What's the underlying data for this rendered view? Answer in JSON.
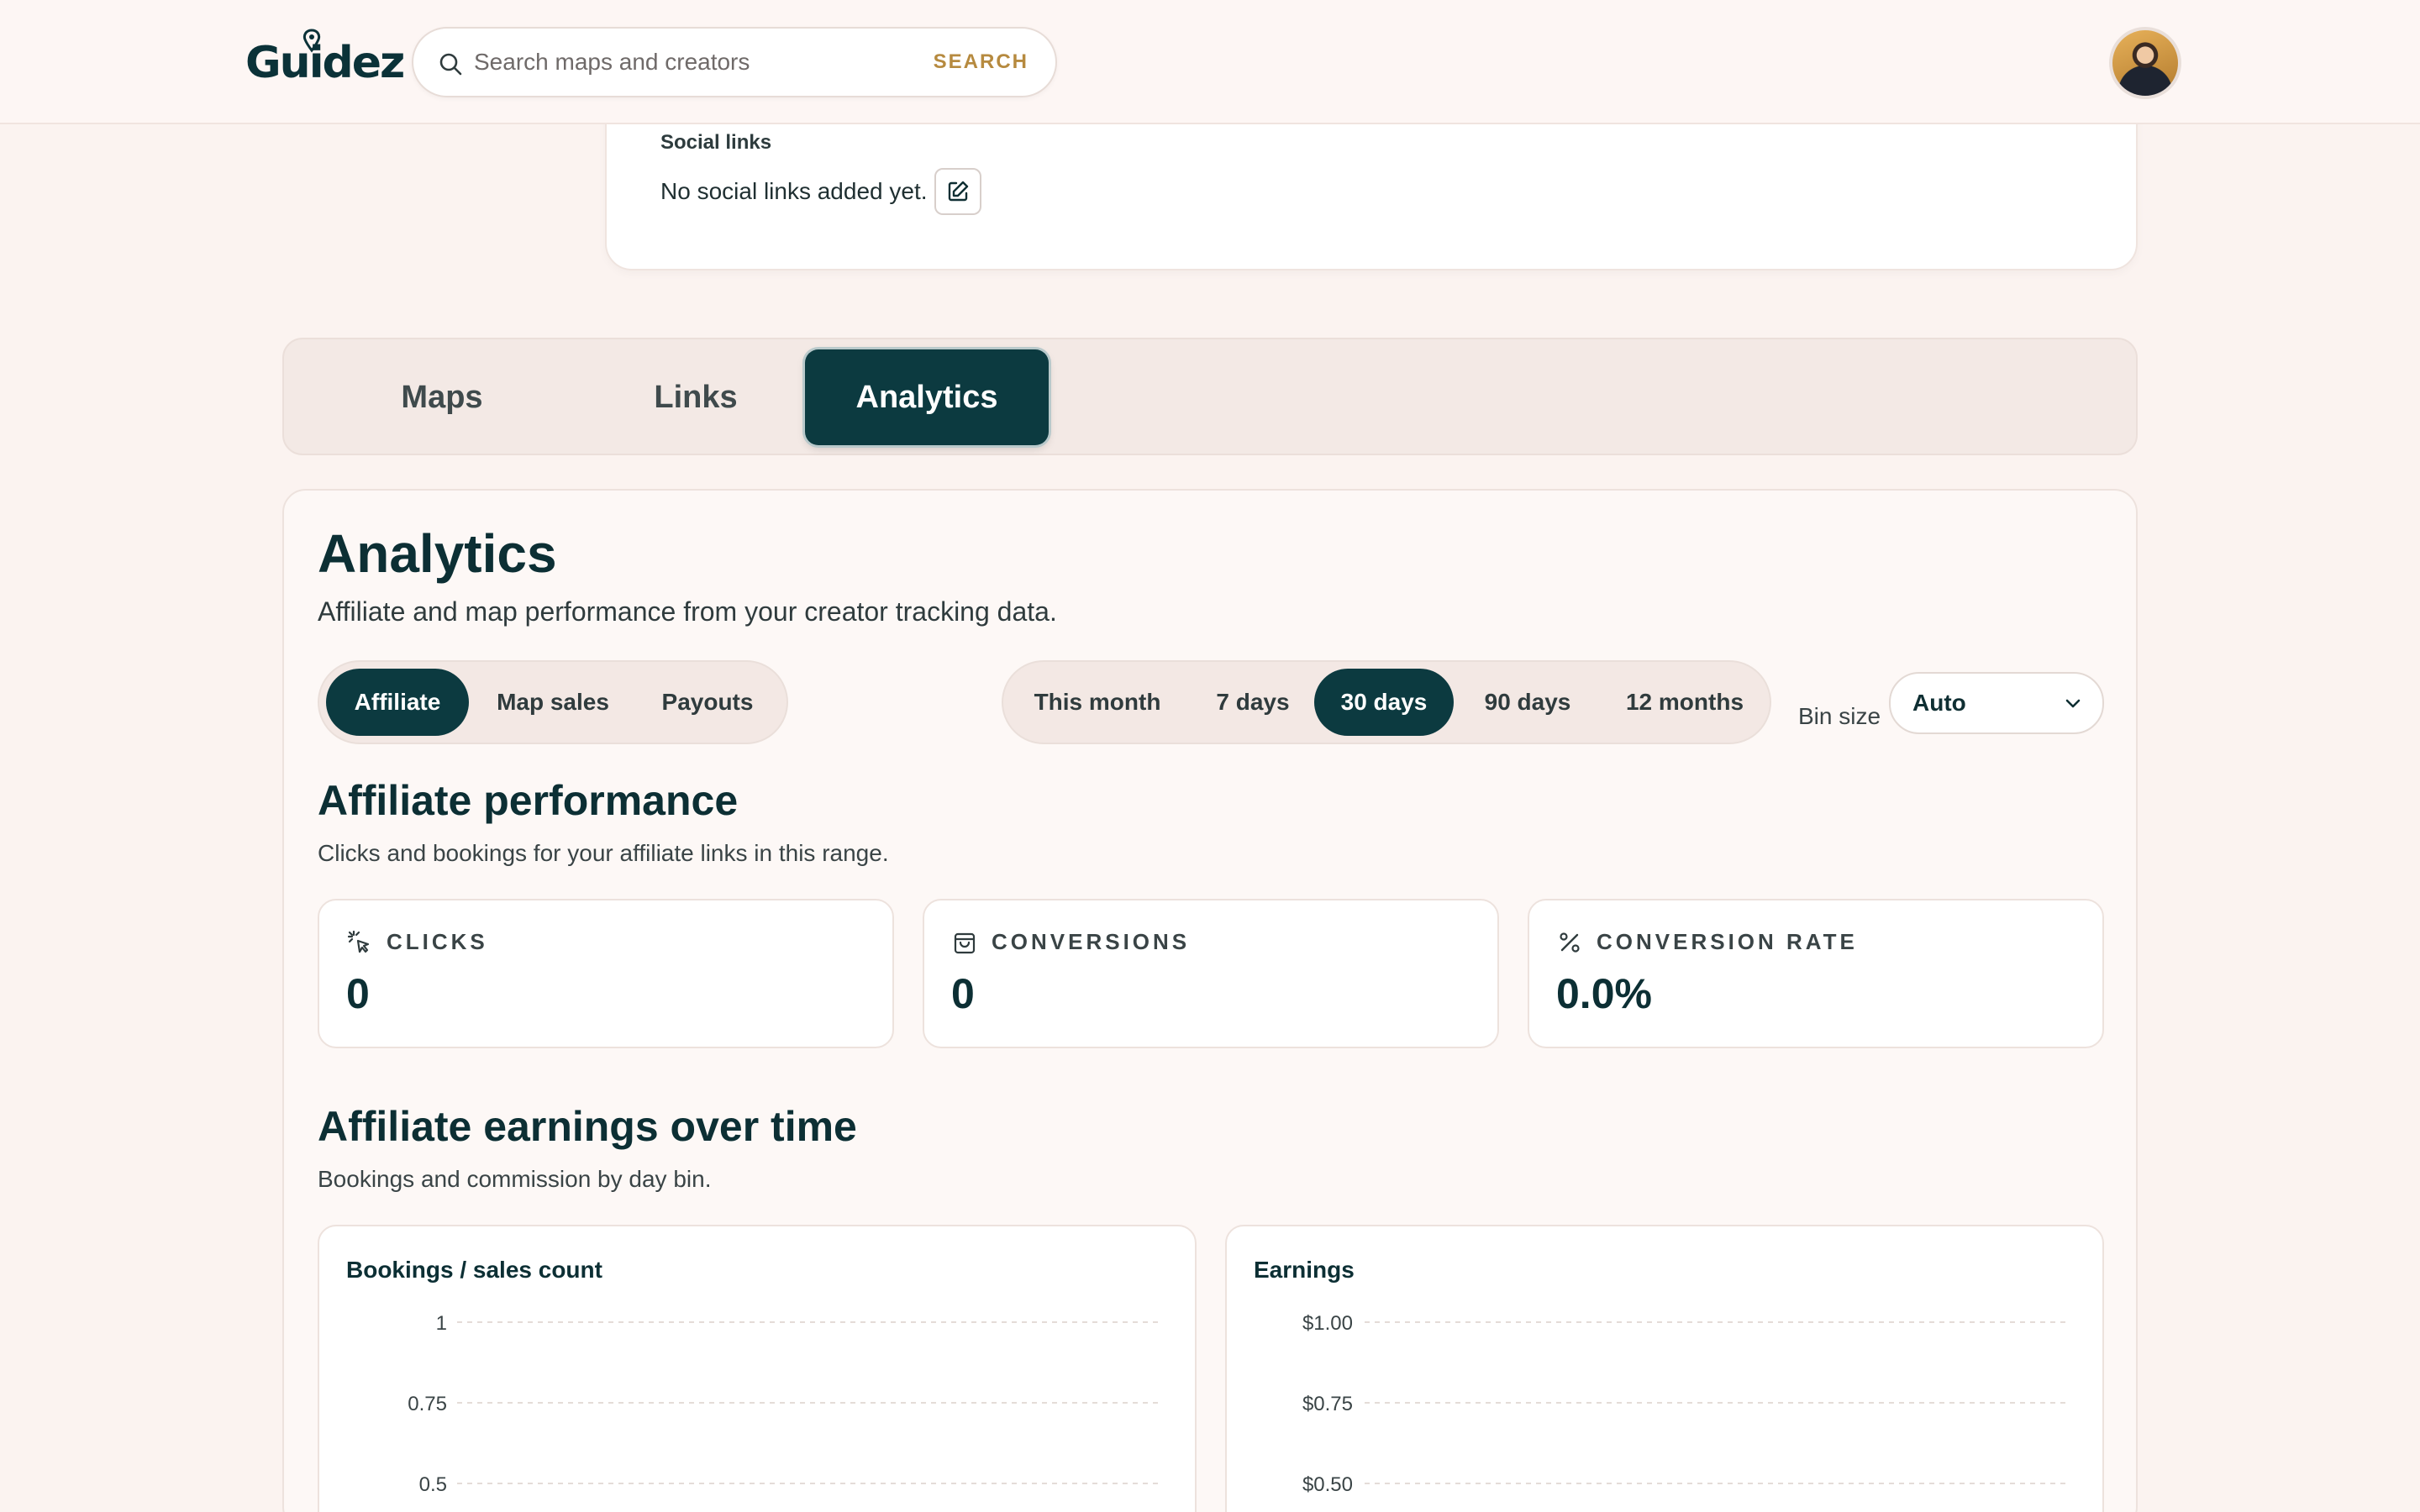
{
  "header": {
    "logo_text": "Guidez",
    "search": {
      "placeholder": "Search maps and creators",
      "button_label": "SEARCH"
    }
  },
  "profile": {
    "social_links_label": "Social links",
    "social_links_empty": "No social links added yet."
  },
  "tabs": [
    {
      "label": "Maps",
      "active": false
    },
    {
      "label": "Links",
      "active": false
    },
    {
      "label": "Analytics",
      "active": true
    }
  ],
  "analytics": {
    "title": "Analytics",
    "subtitle": "Affiliate and map performance from your creator tracking data.",
    "modes": [
      {
        "label": "Affiliate",
        "active": true
      },
      {
        "label": "Map sales",
        "active": false
      },
      {
        "label": "Payouts",
        "active": false
      }
    ],
    "ranges": [
      {
        "label": "This month",
        "active": false
      },
      {
        "label": "7 days",
        "active": false
      },
      {
        "label": "30 days",
        "active": true
      },
      {
        "label": "90 days",
        "active": false
      },
      {
        "label": "12 months",
        "active": false
      }
    ],
    "bin_size": {
      "label": "Bin size",
      "value": "Auto"
    },
    "performance": {
      "title": "Affiliate performance",
      "subtitle": "Clicks and bookings for your affiliate links in this range.",
      "stats": [
        {
          "label": "CLICKS",
          "value": "0",
          "icon": "cursor-click-icon"
        },
        {
          "label": "CONVERSIONS",
          "value": "0",
          "icon": "shopping-bag-icon"
        },
        {
          "label": "CONVERSION RATE",
          "value": "0.0%",
          "icon": "percent-icon"
        }
      ]
    },
    "earnings": {
      "title": "Affiliate earnings over time",
      "subtitle": "Bookings and commission by day bin."
    }
  },
  "colors": {
    "accent": "#0c3a40",
    "search_button": "#b68a3f",
    "background": "#fbf3f0"
  },
  "chart_data": [
    {
      "type": "line",
      "title": "Bookings / sales count",
      "ylim": [
        0,
        1
      ],
      "y_ticks": [
        "1",
        "0.75",
        "0.5"
      ],
      "grid": true
    },
    {
      "type": "line",
      "title": "Earnings",
      "ylim": [
        0,
        1
      ],
      "y_ticks": [
        "$1.00",
        "$0.75",
        "$0.50"
      ],
      "grid": true
    }
  ]
}
